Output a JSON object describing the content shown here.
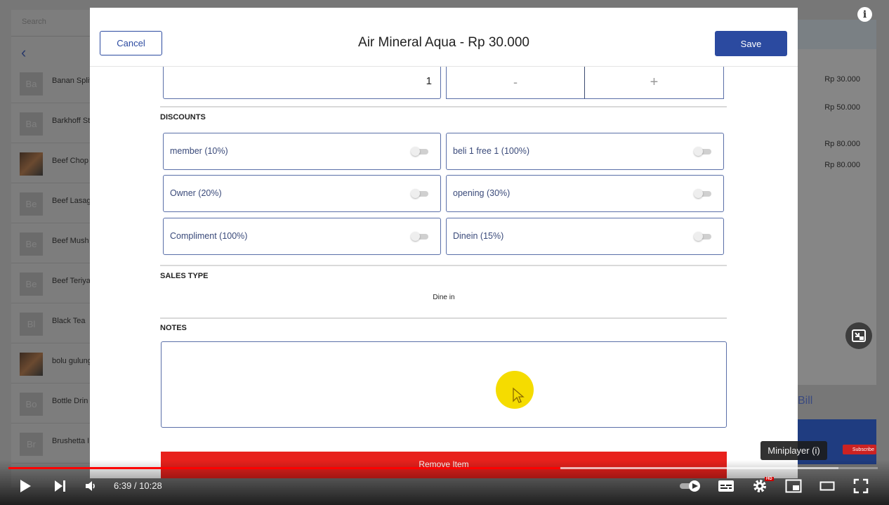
{
  "background_app": {
    "search_placeholder": "Search",
    "products": [
      {
        "thumb": "Ba",
        "name": "Banan Split",
        "photo": false
      },
      {
        "thumb": "Ba",
        "name": "Barkhoff St",
        "photo": false
      },
      {
        "thumb": "",
        "name": "Beef Chop",
        "photo": true
      },
      {
        "thumb": "Be",
        "name": "Beef Lasag",
        "photo": false
      },
      {
        "thumb": "Be",
        "name": "Beef Mush",
        "photo": false
      },
      {
        "thumb": "Be",
        "name": "Beef Teriya",
        "photo": false
      },
      {
        "thumb": "Bl",
        "name": "Black Tea",
        "photo": false
      },
      {
        "thumb": "",
        "name": "bolu gulung",
        "photo": true
      },
      {
        "thumb": "Bo",
        "name": "Bottle Drin",
        "photo": false
      },
      {
        "thumb": "Br",
        "name": "Brushetta I",
        "photo": false
      }
    ],
    "order_prices": [
      "Rp 30.000",
      "Rp 50.000",
      "Rp 80.000",
      "Rp 80.000"
    ],
    "bill_label": "Bill"
  },
  "modal": {
    "cancel_label": "Cancel",
    "title": "Air Mineral Aqua - Rp 30.000",
    "save_label": "Save",
    "quantity": "1",
    "minus_label": "-",
    "plus_label": "+",
    "discounts_heading": "DISCOUNTS",
    "discounts": [
      {
        "label": "member (10%)",
        "enabled": false
      },
      {
        "label": "beli 1 free 1 (100%)",
        "enabled": false
      },
      {
        "label": "Owner (20%)",
        "enabled": false
      },
      {
        "label": "opening (30%)",
        "enabled": false
      },
      {
        "label": "Compliment (100%)",
        "enabled": false
      },
      {
        "label": "Dinein (15%)",
        "enabled": false
      }
    ],
    "sales_type_heading": "SALES TYPE",
    "sales_type_value": "Dine in",
    "notes_heading": "NOTES",
    "notes_value": "",
    "remove_label": "Remove Item"
  },
  "player": {
    "current_time": "6:39",
    "duration": "10:28",
    "time_display": "6:39 / 10:28",
    "progress_played": 0.635,
    "progress_buffered": 0.955,
    "tooltip": "Miniplayer (i)",
    "hd_badge": "HD",
    "subscribe_label": "Subscribe",
    "accent_color": "#ff0000"
  },
  "colors": {
    "primary": "#2b4aa0",
    "danger": "#e8211c",
    "cursor_highlight": "#f5dc00"
  }
}
